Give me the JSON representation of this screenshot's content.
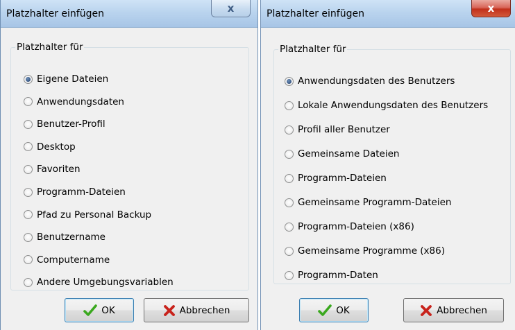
{
  "dialogs": [
    {
      "title": "Platzhalter einfügen",
      "close_glyph": "x",
      "group_label": "Platzhalter für",
      "options": [
        {
          "label": "Eigene Dateien",
          "checked": true
        },
        {
          "label": "Anwendungsdaten",
          "checked": false
        },
        {
          "label": "Benutzer-Profil",
          "checked": false
        },
        {
          "label": "Desktop",
          "checked": false
        },
        {
          "label": "Favoriten",
          "checked": false
        },
        {
          "label": "Programm-Dateien",
          "checked": false
        },
        {
          "label": "Pfad zu Personal Backup",
          "checked": false
        },
        {
          "label": "Benutzername",
          "checked": false
        },
        {
          "label": "Computername",
          "checked": false
        },
        {
          "label": "Andere Umgebungsvariablen",
          "checked": false
        }
      ],
      "ok_label": "OK",
      "cancel_label": "Abbrechen"
    },
    {
      "title": "Platzhalter einfügen",
      "close_glyph": "x",
      "group_label": "Platzhalter für",
      "options": [
        {
          "label": "Anwendungsdaten des Benutzers",
          "checked": true
        },
        {
          "label": "Lokale Anwendungsdaten des Benutzers",
          "checked": false
        },
        {
          "label": "Profil aller Benutzer",
          "checked": false
        },
        {
          "label": "Gemeinsame Dateien",
          "checked": false
        },
        {
          "label": "Programm-Dateien",
          "checked": false
        },
        {
          "label": "Gemeinsame Programm-Dateien",
          "checked": false
        },
        {
          "label": "Programm-Dateien (x86)",
          "checked": false
        },
        {
          "label": "Gemeinsame Programme (x86)",
          "checked": false
        },
        {
          "label": "Programm-Daten",
          "checked": false
        }
      ],
      "ok_label": "OK",
      "cancel_label": "Abbrechen"
    }
  ],
  "icons": {
    "ok": "green-check-icon",
    "cancel": "red-x-icon"
  },
  "colors": {
    "check_green": "#3aa81e",
    "cancel_red": "#c8231c",
    "title_bar": "#bad4ee",
    "close_active": "#c2301b"
  }
}
